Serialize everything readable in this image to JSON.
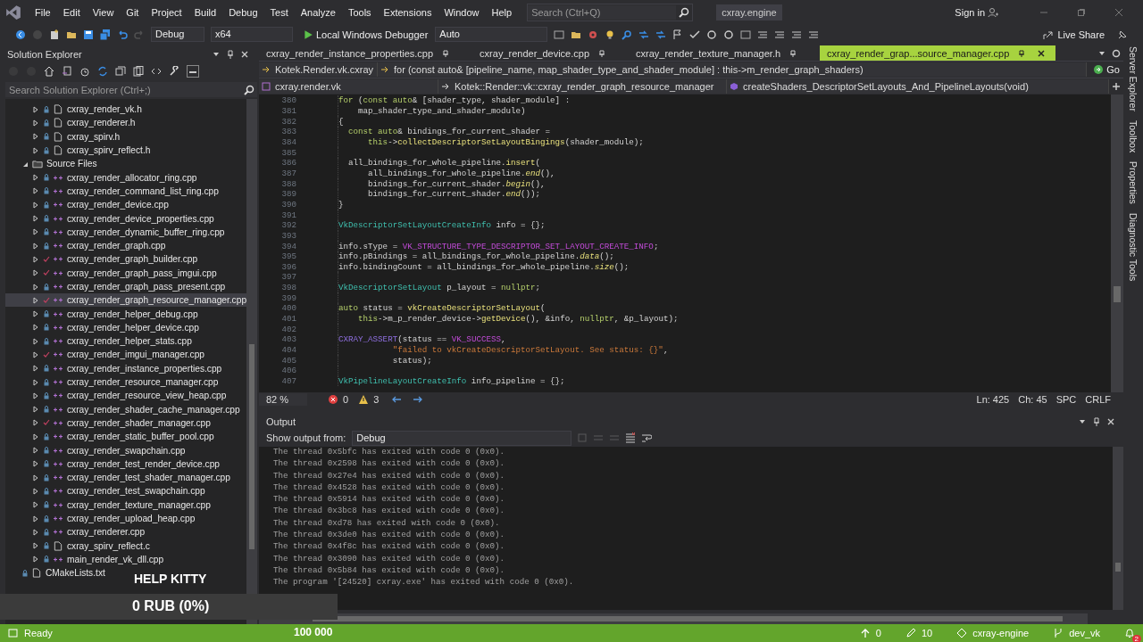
{
  "menu": {
    "items": [
      "File",
      "Edit",
      "View",
      "Git",
      "Project",
      "Build",
      "Debug",
      "Test",
      "Analyze",
      "Tools",
      "Extensions",
      "Window",
      "Help"
    ],
    "search": {
      "placeholder": "Search (Ctrl+Q)"
    },
    "solution_name": "cxray.engine",
    "sign_in": "Sign in"
  },
  "toolbar": {
    "configuration": "Debug",
    "platform": "x64",
    "debugger": "Local Windows Debugger",
    "target": "Auto",
    "live_share": "Live Share"
  },
  "solution_explorer": {
    "title": "Solution Explorer",
    "search": {
      "placeholder": "Search Solution Explorer (Ctrl+;)"
    },
    "tree": [
      {
        "children": [
          {
            "children": [
              {
                "label": "cxray_render_vk.h",
                "kind": "header",
                "expanded": false,
                "modified": false,
                "selected": false
              },
              {
                "label": "cxray_renderer.h",
                "kind": "header",
                "expanded": false,
                "modified": false,
                "selected": false
              },
              {
                "label": "cxray_spirv.h",
                "kind": "header",
                "expanded": false,
                "modified": false,
                "selected": false
              },
              {
                "label": "cxray_spirv_reflect.h",
                "kind": "header",
                "expanded": false,
                "modified": false,
                "selected": false
              }
            ]
          },
          {
            "label": "Source Files",
            "kind": "folder",
            "expanded": true,
            "selected": false,
            "children": [
              {
                "label": "cxray_render_allocator_ring.cpp",
                "kind": "source",
                "expanded": false,
                "modified": false,
                "selected": false
              },
              {
                "label": "cxray_render_command_list_ring.cpp",
                "kind": "source",
                "expanded": false,
                "modified": false,
                "selected": false
              },
              {
                "label": "cxray_render_device.cpp",
                "kind": "source",
                "expanded": false,
                "modified": false,
                "selected": false
              },
              {
                "label": "cxray_render_device_properties.cpp",
                "kind": "source",
                "expanded": false,
                "modified": false,
                "selected": false
              },
              {
                "label": "cxray_render_dynamic_buffer_ring.cpp",
                "kind": "source",
                "expanded": false,
                "modified": false,
                "selected": false
              },
              {
                "label": "cxray_render_graph.cpp",
                "kind": "source",
                "expanded": false,
                "modified": false,
                "selected": false
              },
              {
                "label": "cxray_render_graph_builder.cpp",
                "kind": "source",
                "expanded": false,
                "modified": true,
                "selected": false
              },
              {
                "label": "cxray_render_graph_pass_imgui.cpp",
                "kind": "source",
                "expanded": false,
                "modified": true,
                "selected": false
              },
              {
                "label": "cxray_render_graph_pass_present.cpp",
                "kind": "source",
                "expanded": false,
                "modified": false,
                "selected": false
              },
              {
                "label": "cxray_render_graph_resource_manager.cpp",
                "kind": "source",
                "expanded": false,
                "modified": true,
                "selected": true
              },
              {
                "label": "cxray_render_helper_debug.cpp",
                "kind": "source",
                "expanded": false,
                "modified": false,
                "selected": false
              },
              {
                "label": "cxray_render_helper_device.cpp",
                "kind": "source",
                "expanded": false,
                "modified": false,
                "selected": false
              },
              {
                "label": "cxray_render_helper_stats.cpp",
                "kind": "source",
                "expanded": false,
                "modified": false,
                "selected": false
              },
              {
                "label": "cxray_render_imgui_manager.cpp",
                "kind": "source",
                "expanded": false,
                "modified": true,
                "selected": false
              },
              {
                "label": "cxray_render_instance_properties.cpp",
                "kind": "source",
                "expanded": false,
                "modified": false,
                "selected": false
              },
              {
                "label": "cxray_render_resource_manager.cpp",
                "kind": "source",
                "expanded": false,
                "modified": false,
                "selected": false
              },
              {
                "label": "cxray_render_resource_view_heap.cpp",
                "kind": "source",
                "expanded": false,
                "modified": false,
                "selected": false
              },
              {
                "label": "cxray_render_shader_cache_manager.cpp",
                "kind": "source",
                "expanded": false,
                "modified": false,
                "selected": false
              },
              {
                "label": "cxray_render_shader_manager.cpp",
                "kind": "source",
                "expanded": false,
                "modified": true,
                "selected": false
              },
              {
                "label": "cxray_render_static_buffer_pool.cpp",
                "kind": "source",
                "expanded": false,
                "modified": false,
                "selected": false
              },
              {
                "label": "cxray_render_swapchain.cpp",
                "kind": "source",
                "expanded": false,
                "modified": false,
                "selected": false
              },
              {
                "label": "cxray_render_test_render_device.cpp",
                "kind": "source",
                "expanded": false,
                "modified": false,
                "selected": false
              },
              {
                "label": "cxray_render_test_shader_manager.cpp",
                "kind": "source",
                "expanded": false,
                "modified": false,
                "selected": false
              },
              {
                "label": "cxray_render_test_swapchain.cpp",
                "kind": "source",
                "expanded": false,
                "modified": false,
                "selected": false
              },
              {
                "label": "cxray_render_texture_manager.cpp",
                "kind": "source",
                "expanded": false,
                "modified": false,
                "selected": false
              },
              {
                "label": "cxray_render_upload_heap.cpp",
                "kind": "source",
                "expanded": false,
                "modified": false,
                "selected": false
              },
              {
                "label": "cxray_renderer.cpp",
                "kind": "source",
                "expanded": false,
                "modified": false,
                "selected": false
              },
              {
                "label": "cxray_spirv_reflect.c",
                "kind": "header",
                "expanded": false,
                "modified": false,
                "selected": false
              },
              {
                "label": "main_render_vk_dll.cpp",
                "kind": "source",
                "expanded": false,
                "modified": false,
                "selected": false
              }
            ]
          }
        ]
      },
      {
        "label": "CMakeLists.txt",
        "kind": "text",
        "modified": false,
        "selected": false
      }
    ]
  },
  "editor": {
    "tabs": [
      {
        "label": "cxray_render_instance_properties.cpp",
        "selected": false
      },
      {
        "label": "cxray_render_device.cpp",
        "selected": false
      },
      {
        "label": "cxray_render_texture_manager.h",
        "selected": false
      },
      {
        "label": "cxray_render_grap...source_manager.cpp",
        "selected": true
      }
    ],
    "nav": {
      "scope": "Kotek.Render.vk.cxray",
      "statement": "for (const auto& [pipeline_name, map_shader_type_and_shader_module] : this->m_render_graph_shaders)",
      "go": "Go",
      "project": "cxray.render.vk",
      "class": "Kotek::Render::vk::cxray_render_graph_resource_manager",
      "member": "createShaders_DescriptorSetLayouts_And_PipelineLayouts(void)"
    },
    "lines": [
      {
        "n": "380",
        "code": [
          {
            "kind": "kw",
            "t": "for"
          },
          {
            "kind": "p",
            "t": " ("
          },
          {
            "kind": "kw",
            "t": "const auto"
          },
          {
            "kind": "p",
            "t": "& [shader_type, shader_module] :"
          }
        ]
      },
      {
        "n": "381",
        "code": [
          {
            "kind": "p",
            "t": "    map_shader_type_and_shader_module)"
          }
        ]
      },
      {
        "n": "382",
        "code": [
          {
            "kind": "p",
            "t": "{"
          }
        ]
      },
      {
        "n": "383",
        "code": [
          {
            "kind": "kw",
            "t": "  const auto"
          },
          {
            "kind": "p",
            "t": "& bindings_for_current_shader ="
          }
        ]
      },
      {
        "n": "384",
        "code": [
          {
            "kind": "kw",
            "t": "      this"
          },
          {
            "kind": "p",
            "t": "->"
          },
          {
            "kind": "fn",
            "t": "collectDescriptorSetLayoutBingings"
          },
          {
            "kind": "p",
            "t": "(shader_module);"
          }
        ]
      },
      {
        "n": "385"
      },
      {
        "n": "386",
        "code": [
          {
            "kind": "p",
            "t": "  all_bindings_for_whole_pipeline."
          },
          {
            "kind": "fn",
            "t": "insert"
          },
          {
            "kind": "p",
            "t": "("
          }
        ]
      },
      {
        "n": "387",
        "code": [
          {
            "kind": "p",
            "t": "      all_bindings_for_whole_pipeline."
          },
          {
            "kind": "fni",
            "t": "end"
          },
          {
            "kind": "p",
            "t": "(),"
          }
        ]
      },
      {
        "n": "388",
        "code": [
          {
            "kind": "p",
            "t": "      bindings_for_current_shader."
          },
          {
            "kind": "fni",
            "t": "begin"
          },
          {
            "kind": "p",
            "t": "(),"
          }
        ]
      },
      {
        "n": "389",
        "code": [
          {
            "kind": "p",
            "t": "      bindings_for_current_shader."
          },
          {
            "kind": "fni",
            "t": "end"
          },
          {
            "kind": "p",
            "t": "());"
          }
        ]
      },
      {
        "n": "390",
        "code": [
          {
            "kind": "p",
            "t": "}"
          }
        ]
      },
      {
        "n": "391"
      },
      {
        "n": "392",
        "code": [
          {
            "kind": "type",
            "t": "VkDescriptorSetLayoutCreateInfo"
          },
          {
            "kind": "p",
            "t": " info = {};"
          }
        ]
      },
      {
        "n": "393"
      },
      {
        "n": "394",
        "code": [
          {
            "kind": "p",
            "t": "info.sType = "
          },
          {
            "kind": "enum",
            "t": "VK_STRUCTURE_TYPE_DESCRIPTOR_SET_LAYOUT_CREATE_INFO"
          },
          {
            "kind": "p",
            "t": ";"
          }
        ]
      },
      {
        "n": "395",
        "code": [
          {
            "kind": "p",
            "t": "info.pBindings = all_bindings_for_whole_pipeline."
          },
          {
            "kind": "fni",
            "t": "data"
          },
          {
            "kind": "p",
            "t": "();"
          }
        ]
      },
      {
        "n": "396",
        "code": [
          {
            "kind": "p",
            "t": "info.bindingCount = all_bindings_for_whole_pipeline."
          },
          {
            "kind": "fni",
            "t": "size"
          },
          {
            "kind": "p",
            "t": "();"
          }
        ]
      },
      {
        "n": "397"
      },
      {
        "n": "398",
        "code": [
          {
            "kind": "type",
            "t": "VkDescriptorSetLayout"
          },
          {
            "kind": "p",
            "t": " p_layout = "
          },
          {
            "kind": "kw",
            "t": "nullptr"
          },
          {
            "kind": "p",
            "t": ";"
          }
        ]
      },
      {
        "n": "399"
      },
      {
        "n": "400",
        "code": [
          {
            "kind": "kw",
            "t": "auto"
          },
          {
            "kind": "p",
            "t": " status = "
          },
          {
            "kind": "fn",
            "t": "vkCreateDescriptorSetLayout"
          },
          {
            "kind": "p",
            "t": "("
          }
        ]
      },
      {
        "n": "401",
        "code": [
          {
            "kind": "kw",
            "t": "    this"
          },
          {
            "kind": "p",
            "t": "->m_p_render_device->"
          },
          {
            "kind": "fn",
            "t": "getDevice"
          },
          {
            "kind": "p",
            "t": "(), &info, "
          },
          {
            "kind": "kw",
            "t": "nullptr"
          },
          {
            "kind": "p",
            "t": ", &p_layout);"
          }
        ]
      },
      {
        "n": "402"
      },
      {
        "n": "403",
        "code": [
          {
            "kind": "macro",
            "t": "CXRAY_ASSERT"
          },
          {
            "kind": "p",
            "t": "(status == "
          },
          {
            "kind": "enum",
            "t": "VK_SUCCESS"
          },
          {
            "kind": "p",
            "t": ","
          }
        ]
      },
      {
        "n": "404",
        "code": [
          {
            "kind": "str",
            "t": "           \"failed to vkCreateDescriptorSetLayout. See status: {}\""
          },
          {
            "kind": "p",
            "t": ","
          }
        ]
      },
      {
        "n": "405",
        "code": [
          {
            "kind": "p",
            "t": "           status);"
          }
        ]
      },
      {
        "n": "406"
      },
      {
        "n": "407",
        "code": [
          {
            "kind": "type",
            "t": "VkPipelineLayoutCreateInfo"
          },
          {
            "kind": "p",
            "t": " info_pipeline = {};"
          }
        ]
      }
    ],
    "status": {
      "zoom": "82 %",
      "errors": "0",
      "warnings": "3",
      "line": "Ln: 425",
      "column": "Ch: 45",
      "whitespace": "SPC",
      "line_endings": "CRLF"
    }
  },
  "side_tabs": [
    "Server Explorer",
    "Toolbox",
    "Properties",
    "Diagnostic Tools"
  ],
  "output": {
    "title": "Output",
    "source_label": "Show output from:",
    "source": "Debug",
    "lines": [
      "The thread 0x5bfc has exited with code 0 (0x0).",
      "The thread 0x2598 has exited with code 0 (0x0).",
      "The thread 0x27e4 has exited with code 0 (0x0).",
      "The thread 0x4528 has exited with code 0 (0x0).",
      "The thread 0x5914 has exited with code 0 (0x0).",
      "The thread 0x3bc8 has exited with code 0 (0x0).",
      "The thread 0xd78 has exited with code 0 (0x0).",
      "The thread 0x3de0 has exited with code 0 (0x0).",
      "The thread 0x4f8c has exited with code 0 (0x0).",
      "The thread 0x3090 has exited with code 0 (0x0).",
      "The thread 0x5b84 has exited with code 0 (0x0).",
      "The program '[24520] cxray.exe' has exited with code 0 (0x0)."
    ]
  },
  "status_bar": {
    "state": "Ready",
    "pushes": "0",
    "changes": "10",
    "repository": "cxray-engine",
    "branch": "dev_vk",
    "notifications": "2"
  },
  "donation": {
    "title": "HELP KITTY",
    "amount": "0 RUB (0%)",
    "goal": "100 000",
    "level": 0
  }
}
